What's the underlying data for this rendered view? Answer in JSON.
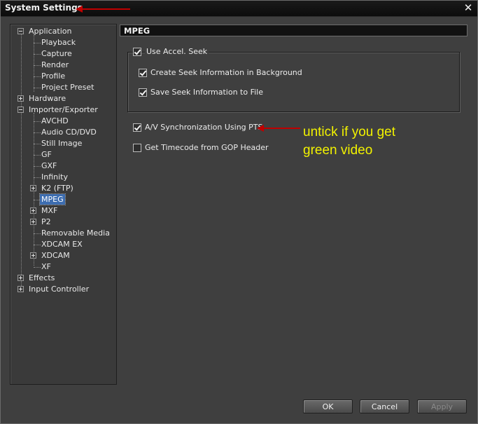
{
  "window": {
    "title": "System Settings",
    "close_icon": "close-icon"
  },
  "tree": {
    "items": [
      {
        "label": "Application",
        "expander": "minus"
      },
      {
        "label": "Playback"
      },
      {
        "label": "Capture"
      },
      {
        "label": "Render"
      },
      {
        "label": "Profile"
      },
      {
        "label": "Project Preset"
      },
      {
        "label": "Hardware",
        "expander": "plus"
      },
      {
        "label": "Importer/Exporter",
        "expander": "minus"
      },
      {
        "label": "AVCHD"
      },
      {
        "label": "Audio CD/DVD"
      },
      {
        "label": "Still Image"
      },
      {
        "label": "GF"
      },
      {
        "label": "GXF"
      },
      {
        "label": "Infinity"
      },
      {
        "label": "K2 (FTP)",
        "expander": "plus"
      },
      {
        "label": "MPEG",
        "selected": true
      },
      {
        "label": "MXF",
        "expander": "plus"
      },
      {
        "label": "P2",
        "expander": "plus"
      },
      {
        "label": "Removable Media"
      },
      {
        "label": "XDCAM EX"
      },
      {
        "label": "XDCAM",
        "expander": "plus"
      },
      {
        "label": "XF"
      },
      {
        "label": "Effects",
        "expander": "plus"
      },
      {
        "label": "Input Controller",
        "expander": "plus"
      }
    ]
  },
  "panel": {
    "header": "MPEG",
    "use_accel_seek": {
      "label": "Use Accel. Seek",
      "checked": true
    },
    "create_seek_info": {
      "label": "Create Seek Information in Background",
      "checked": true
    },
    "save_seek_info": {
      "label": "Save Seek Information to File",
      "checked": true
    },
    "av_sync_pts": {
      "label": "A/V Synchronization Using PTS",
      "checked": true
    },
    "timecode_gop": {
      "label": "Get Timecode from GOP Header",
      "checked": false
    }
  },
  "annotation": {
    "line1": "untick if you get",
    "line2": "green video",
    "arrow_color": "#c00000",
    "text_color": "#f2f200"
  },
  "buttons": {
    "ok": "OK",
    "cancel": "Cancel",
    "apply": "Apply"
  }
}
